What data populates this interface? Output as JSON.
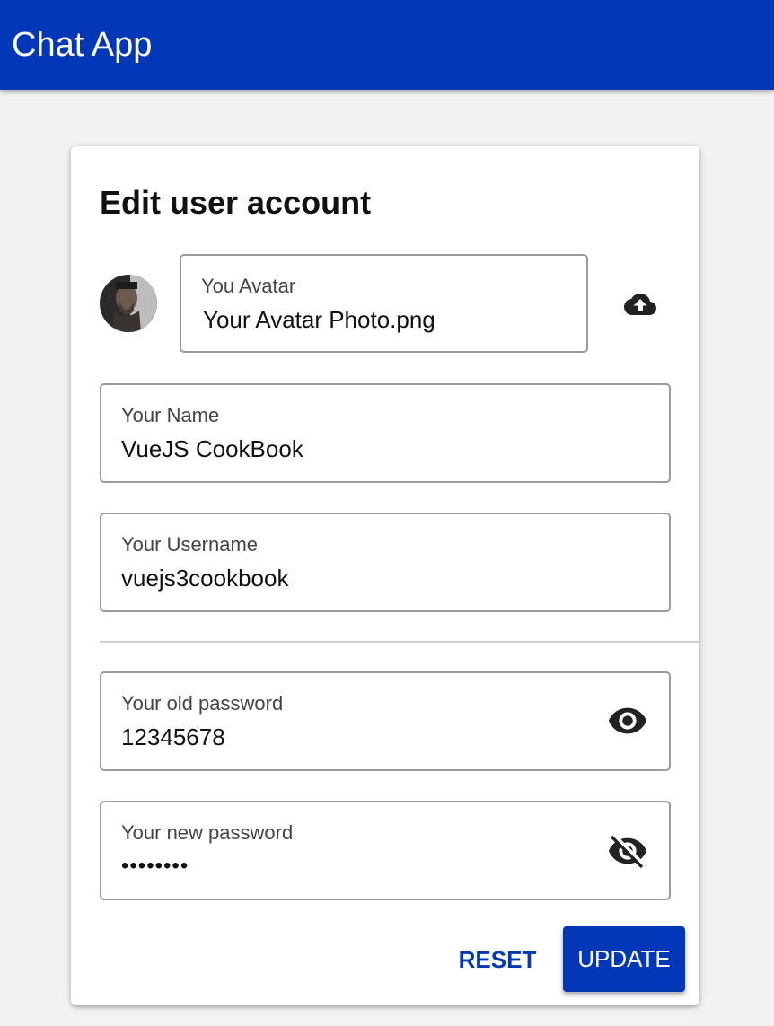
{
  "appbar": {
    "title": "Chat App",
    "color": "#0238b8"
  },
  "form": {
    "title": "Edit user account",
    "avatar": {
      "label": "You Avatar",
      "value": "Your Avatar Photo.png",
      "upload_icon": "cloud-upload-icon"
    },
    "name": {
      "label": "Your Name",
      "value": "VueJS CookBook"
    },
    "username": {
      "label": "Your Username",
      "value": "vuejs3cookbook"
    },
    "old_password": {
      "label": "Your old password",
      "value": "12345678",
      "toggle_icon": "eye-icon"
    },
    "new_password": {
      "label": "Your new password",
      "value": "••••••••",
      "toggle_icon": "eye-off-icon"
    },
    "actions": {
      "reset_label": "RESET",
      "update_label": "UPDATE"
    }
  }
}
